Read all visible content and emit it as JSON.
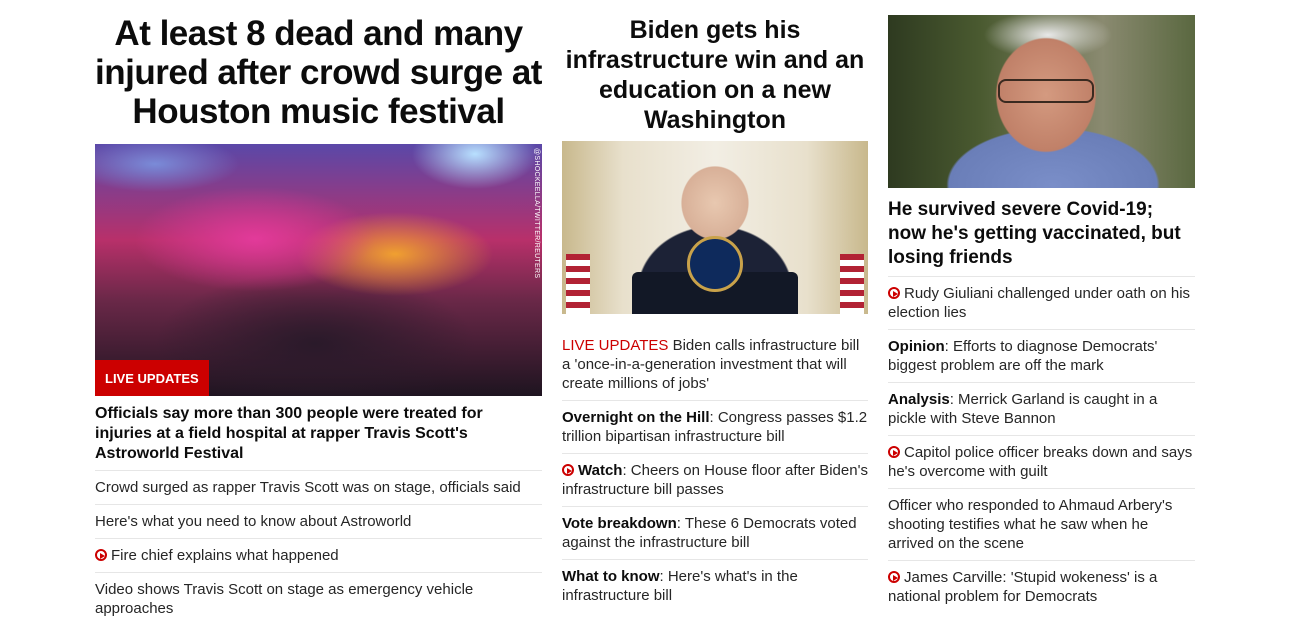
{
  "col1": {
    "headline": "At least 8 dead and many injured after crowd surge at Houston music festival",
    "photo_credit": "@SHOCKEELLA/TWITTER/REUTERS",
    "badge": "LIVE UPDATES",
    "lead": "Officials say more than 300 people were treated for injuries at a field hospital at rapper Travis Scott's Astroworld Festival",
    "items": [
      {
        "text": "Crowd surged as rapper Travis Scott was on stage, officials said"
      },
      {
        "text": "Here's what you need to know about Astroworld"
      },
      {
        "text": "Fire chief explains what happened",
        "icon": "play-icon"
      },
      {
        "text": "Video shows Travis Scott on stage as emergency vehicle approaches"
      }
    ]
  },
  "col2": {
    "headline": "Biden gets his infrastructure win and an education on a new Washington",
    "items": [
      {
        "prefix": "LIVE UPDATES",
        "text": " Biden calls infrastructure bill a 'once-in-a-generation investment that will create millions of jobs'"
      },
      {
        "prefix": "Overnight on the Hill",
        "text": ": Congress passes $1.2 trillion bipartisan infrastructure bill"
      },
      {
        "prefix": "Watch",
        "text": ": Cheers on House floor after Biden's infrastructure bill passes",
        "icon": "play-icon"
      },
      {
        "prefix": "Vote breakdown",
        "text": ": These 6 Democrats voted against the infrastructure bill"
      },
      {
        "prefix": "What to know",
        "text": ": Here's what's in the infrastructure bill"
      }
    ]
  },
  "col3": {
    "lead": "He survived severe Covid-19; now he's getting vaccinated, but losing friends",
    "items": [
      {
        "text": "Rudy Giuliani challenged under oath on his election lies",
        "icon": "play-icon"
      },
      {
        "prefix": "Opinion",
        "text": ": Efforts to diagnose Democrats' biggest problem are off the mark"
      },
      {
        "prefix": "Analysis",
        "text": ": Merrick Garland is caught in a pickle with Steve Bannon"
      },
      {
        "text": "Capitol police officer breaks down and says he's overcome with guilt",
        "icon": "play-icon"
      },
      {
        "text": "Officer who responded to Ahmaud Arbery's shooting testifies what he saw when he arrived on the scene"
      },
      {
        "text": "James Carville: 'Stupid wokeness' is a national problem for Democrats",
        "icon": "play-icon"
      }
    ]
  },
  "colors": {
    "accent_red": "#cc0000",
    "text": "#0c0c0c",
    "divider": "#e6e6e6"
  }
}
